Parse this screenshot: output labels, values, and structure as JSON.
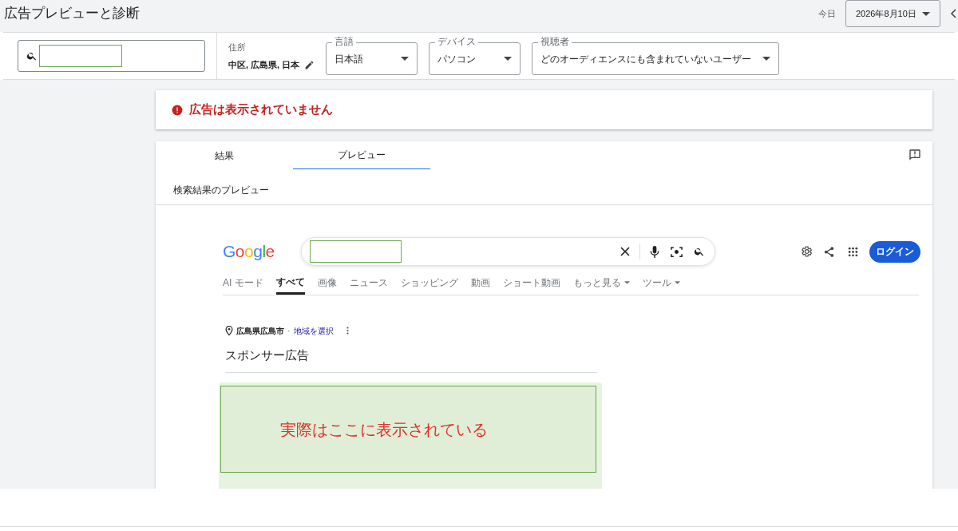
{
  "header": {
    "title": "広告プレビューと診断",
    "today_label": "今日",
    "date": "2026年8月10日"
  },
  "filters": {
    "location_label": "住所",
    "location": "中区, 広島県, 日本",
    "dropdowns": [
      {
        "label": "言語",
        "value": "日本語"
      },
      {
        "label": "デバイス",
        "value": "パソコン"
      },
      {
        "label": "視聴者",
        "value": "どのオーディエンスにも含まれていないユーザー"
      }
    ]
  },
  "alert": {
    "message": "広告は表示されていません"
  },
  "tabs": [
    {
      "label": "結果",
      "selected": false
    },
    {
      "label": "プレビュー",
      "selected": true
    }
  ],
  "preview_title": "検索結果のプレビュー",
  "serp": {
    "logo": "Google",
    "login": "ログイン",
    "nav": [
      {
        "label": "AI モード",
        "selected": false,
        "menu": false
      },
      {
        "label": "すべて",
        "selected": true,
        "menu": false
      },
      {
        "label": "画像",
        "selected": false,
        "menu": false
      },
      {
        "label": "ニュース",
        "selected": false,
        "menu": false
      },
      {
        "label": "ショッピング",
        "selected": false,
        "menu": false
      },
      {
        "label": "動画",
        "selected": false,
        "menu": false
      },
      {
        "label": "ショート動画",
        "selected": false,
        "menu": false
      },
      {
        "label": "もっと見る",
        "selected": false,
        "menu": true
      },
      {
        "label": "ツール",
        "selected": false,
        "menu": true
      }
    ],
    "location": "広島県広島市",
    "separator": "·",
    "location_link": "地域を選択",
    "sponsored": "スポンサー広告",
    "annotation": "実際はここに表示されている"
  }
}
